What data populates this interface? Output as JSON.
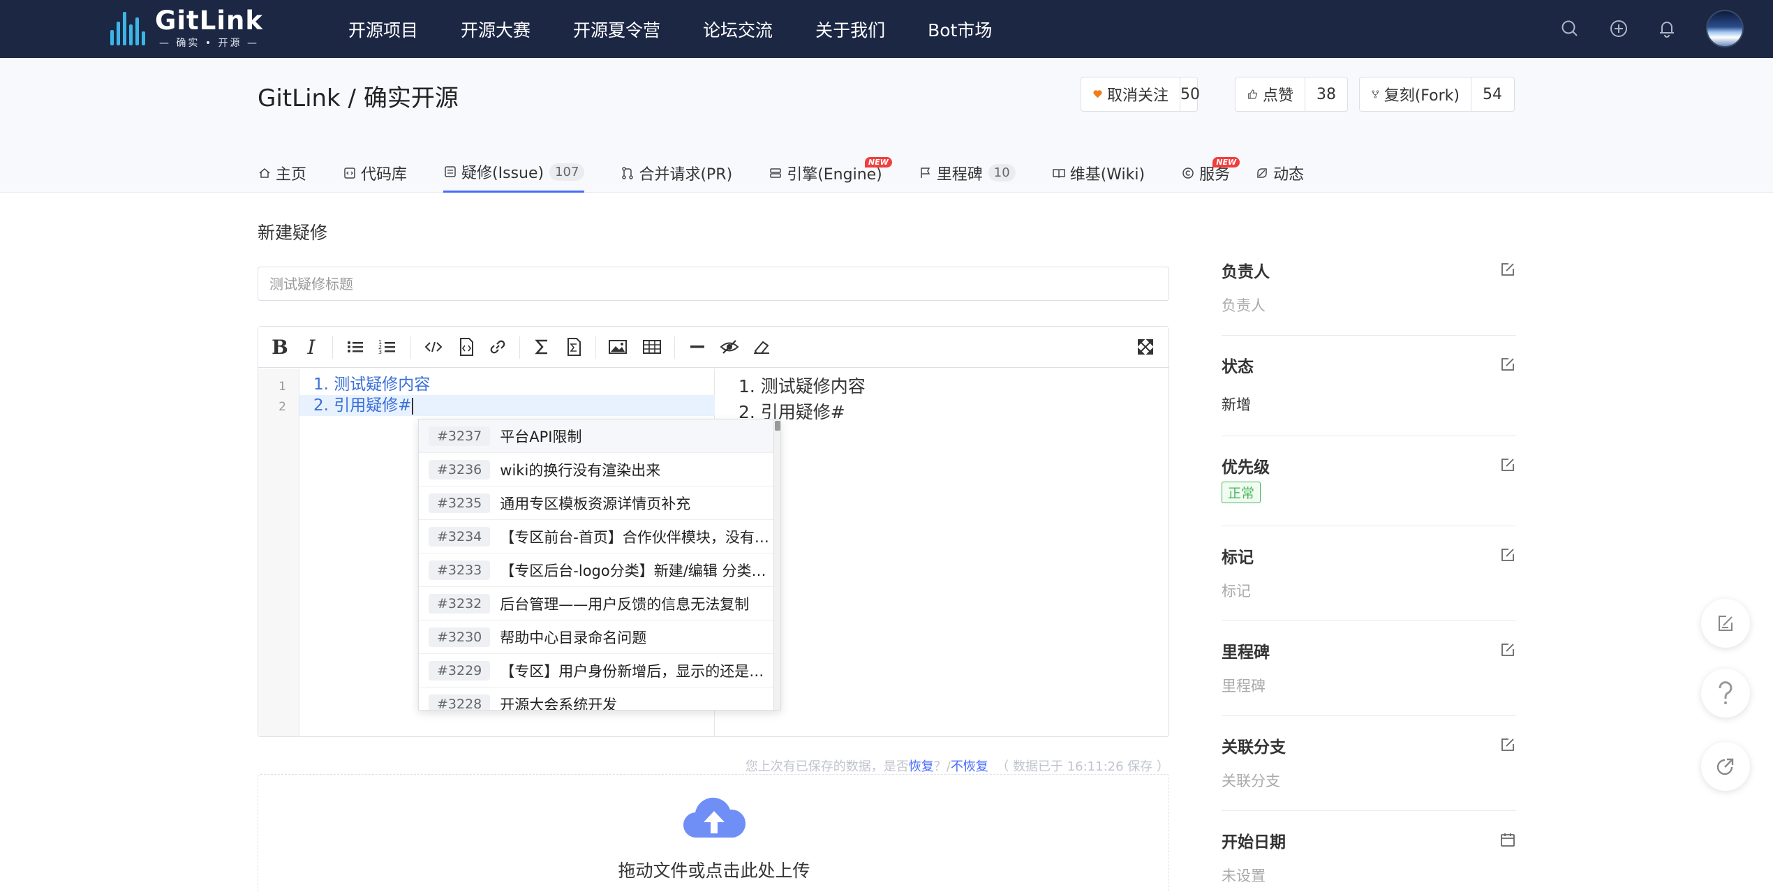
{
  "brand": {
    "name": "GitLink",
    "tagline": "— 确实 • 开源 —"
  },
  "nav": {
    "items": [
      "开源项目",
      "开源大赛",
      "开源夏令营",
      "论坛交流",
      "关于我们",
      "Bot市场"
    ],
    "icons": [
      "search-icon",
      "plus-circle-icon",
      "bell-icon"
    ]
  },
  "repo": {
    "title": "GitLink / 确实开源",
    "watch": {
      "label": "取消关注",
      "count": "50"
    },
    "like": {
      "label": "点赞",
      "count": "38"
    },
    "fork": {
      "label": "复刻(Fork)",
      "count": "54"
    }
  },
  "tabs": [
    {
      "label": "主页"
    },
    {
      "label": "代码库"
    },
    {
      "label": "疑修(Issue)",
      "count": "107",
      "active": true
    },
    {
      "label": "合并请求(PR)"
    },
    {
      "label": "引擎(Engine)",
      "badge": "NEW"
    },
    {
      "label": "里程碑",
      "count": "10"
    },
    {
      "label": "维基(Wiki)"
    },
    {
      "label": "服务",
      "badge": "NEW"
    },
    {
      "label": "动态"
    }
  ],
  "page": {
    "heading": "新建疑修",
    "title_placeholder": "测试疑修标题"
  },
  "editor": {
    "line_numbers": [
      "1",
      "2"
    ],
    "lines": [
      "1. 测试疑修内容",
      "2. 引用疑修#"
    ],
    "preview": [
      "1. 测试疑修内容",
      "2. 引用疑修#"
    ]
  },
  "suggestions": [
    {
      "num": "#3237",
      "title": "平台API限制"
    },
    {
      "num": "#3236",
      "title": "wiki的换行没有渲染出来"
    },
    {
      "num": "#3235",
      "title": "通用专区模板资源详情页补充"
    },
    {
      "num": "#3234",
      "title": "【专区前台-首页】合作伙伴模块，没有logo…"
    },
    {
      "num": "#3233",
      "title": "【专区后台-logo分类】新建/编辑 分类名称…"
    },
    {
      "num": "#3232",
      "title": "后台管理——用户反馈的信息无法复制"
    },
    {
      "num": "#3230",
      "title": "帮助中心目录命名问题"
    },
    {
      "num": "#3229",
      "title": "【专区】用户身份新增后，显示的还是原来…"
    },
    {
      "num": "#3228",
      "title": "开源大会系统开发"
    }
  ],
  "draft": {
    "prefix": "您上次有已保存的数据，是否",
    "restore": "恢复",
    "sep": "？/",
    "discard": "不恢复",
    "saved": "（ 数据已于 16:11:26 保存 ）"
  },
  "upload": {
    "text": "拖动文件或点击此处上传"
  },
  "sidebar": [
    {
      "label": "负责人",
      "value": "负责人"
    },
    {
      "label": "状态",
      "value": "新增"
    },
    {
      "label": "优先级",
      "value": "正常"
    },
    {
      "label": "标记",
      "value": "标记"
    },
    {
      "label": "里程碑",
      "value": "里程碑"
    },
    {
      "label": "关联分支",
      "value": "关联分支"
    },
    {
      "label": "开始日期",
      "value": "未设置"
    }
  ],
  "colors": {
    "nav_bg": "#1c2744",
    "accent": "#466aff",
    "heart": "#f07c1b",
    "badge_new": "#f03e3e",
    "tag_green": "#4bb55a"
  }
}
